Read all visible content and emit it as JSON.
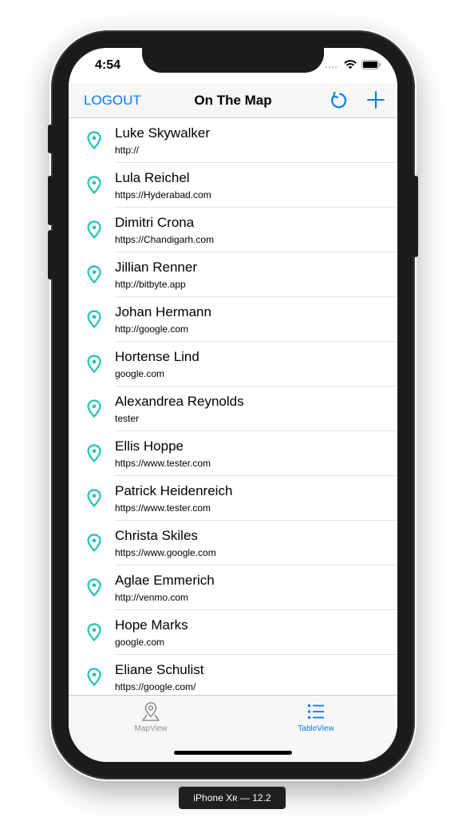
{
  "status": {
    "time": "4:54"
  },
  "navbar": {
    "logout_label": "LOGOUT",
    "title": "On The Map"
  },
  "students": [
    {
      "name": "Luke Skywalker",
      "url": "http://"
    },
    {
      "name": "Lula Reichel",
      "url": "https://Hyderabad.com"
    },
    {
      "name": "Dimitri Crona",
      "url": "https://Chandigarh.com"
    },
    {
      "name": "Jillian Renner",
      "url": "http://bitbyte.app"
    },
    {
      "name": "Johan Hermann",
      "url": "http://google.com"
    },
    {
      "name": "Hortense Lind",
      "url": "google.com"
    },
    {
      "name": "Alexandrea Reynolds",
      "url": "tester"
    },
    {
      "name": "Ellis Hoppe",
      "url": "https://www.tester.com"
    },
    {
      "name": "Patrick Heidenreich",
      "url": "https://www.tester.com"
    },
    {
      "name": "Christa Skiles",
      "url": "https://www.google.com"
    },
    {
      "name": "Aglae Emmerich",
      "url": "http://venmo.com"
    },
    {
      "name": "Hope Marks",
      "url": "google.com"
    },
    {
      "name": "Eliane Schulist",
      "url": "https://google.com/"
    }
  ],
  "tabbar": {
    "tabs": [
      {
        "label": "MapView",
        "icon": "map-pin-icon",
        "selected": false
      },
      {
        "label": "TableView",
        "icon": "list-icon",
        "selected": true
      }
    ]
  },
  "device_label": "iPhone Xʀ — 12.2",
  "colors": {
    "accent": "#007aff",
    "pin": "#1fc2b0",
    "tab_inactive": "#8e8e93"
  }
}
